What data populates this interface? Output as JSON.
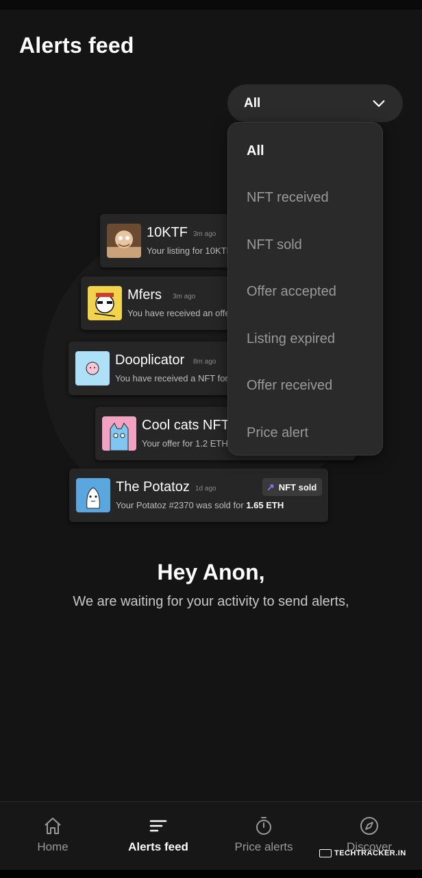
{
  "header": {
    "title": "Alerts feed"
  },
  "filter": {
    "selected": "All",
    "options": [
      "All",
      "NFT received",
      "NFT sold",
      "Offer accepted",
      "Listing expired",
      "Offer received",
      "Price alert"
    ]
  },
  "cards": [
    {
      "name": "10KTF",
      "time": "3m ago",
      "message": "Your listing for 10KTF"
    },
    {
      "name": "Mfers",
      "time": "3m ago",
      "message": "You have received an offe"
    },
    {
      "name": "Dooplicator",
      "time": "8m ago",
      "message": "You have received a NFT for"
    },
    {
      "name": "Cool cats NFT",
      "time": "",
      "message": "Your offer for 1.2 ETH"
    },
    {
      "name": "The Potatoz",
      "time": "1d ago",
      "message": "Your  Potatoz #2370 was sold for ",
      "amount": "1.65 ETH",
      "badge": "NFT sold"
    }
  ],
  "empty_state": {
    "title": "Hey Anon,",
    "subtitle": "We are waiting for your activity to send alerts,"
  },
  "bottom_nav": [
    {
      "label": "Home",
      "icon": "home-icon",
      "active": false
    },
    {
      "label": "Alerts feed",
      "icon": "feed-icon",
      "active": true
    },
    {
      "label": "Price alerts",
      "icon": "timer-icon",
      "active": false
    },
    {
      "label": "Discover",
      "icon": "compass-icon",
      "active": false
    }
  ],
  "watermark": "TECHTRACKER.IN",
  "colors": {
    "background": "#141414",
    "surface": "#2a2a2a",
    "accent": "#8e7bff"
  }
}
